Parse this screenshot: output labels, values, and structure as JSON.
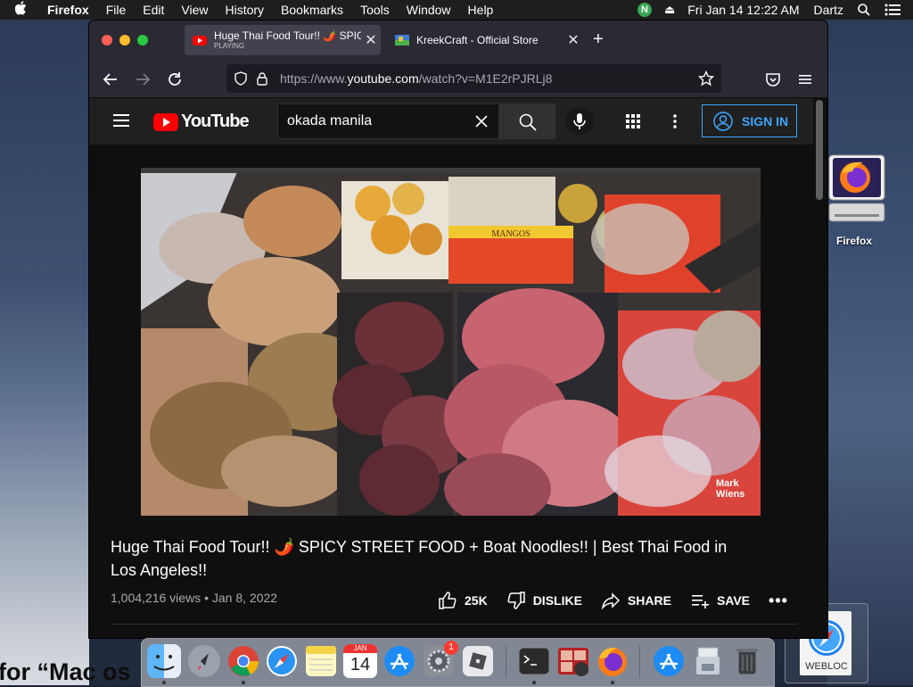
{
  "menubar": {
    "app": "Firefox",
    "items": [
      "File",
      "Edit",
      "View",
      "History",
      "Bookmarks",
      "Tools",
      "Window",
      "Help"
    ],
    "status_letter": "N",
    "datetime": "Fri Jan 14  12:22 AM",
    "user": "Dartz"
  },
  "browser": {
    "tabs": [
      {
        "title": "Huge Thai Food Tour!! 🌶️ SPICY",
        "status": "PLAYING",
        "active": true
      },
      {
        "title": "KreekCraft - Official Store",
        "active": false
      }
    ],
    "url_prefix": "https://www.",
    "url_domain": "youtube.com",
    "url_path": "/watch?v=M1E2rPJRLj8"
  },
  "youtube": {
    "logo_text": "YouTube",
    "search_value": "okada manila",
    "signin_label": "SIGN IN",
    "video": {
      "title": "Huge Thai Food Tour!! 🌶️ SPICY STREET FOOD + Boat Noodles!! | Best Thai Food in Los Angeles!!",
      "views": "1,004,216 views",
      "date": "Jan 8, 2022",
      "meta_sep": " • ",
      "likes": "25K",
      "dislike_label": "DISLIKE",
      "share_label": "SHARE",
      "save_label": "SAVE",
      "watermark": "Mark\nWiens",
      "crate_label": "MANGOS"
    }
  },
  "desktop": {
    "firefox_label": "Firefox",
    "webloc_label": "WEBLOC",
    "background_text": "for “Mac os"
  },
  "dock": {
    "calendar_month": "JAN",
    "calendar_day": "14",
    "badge_count": "1"
  },
  "colors": {
    "youtube_red": "#ff0000",
    "signin_blue": "#3ea6ff",
    "firefox_chrome": "#2b2a33"
  }
}
